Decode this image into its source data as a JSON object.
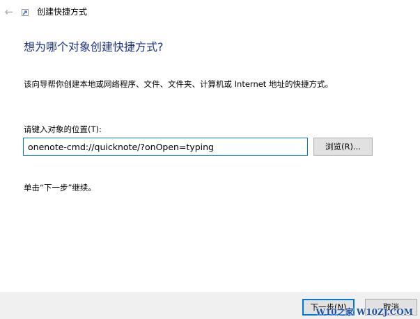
{
  "window": {
    "title": "创建快捷方式",
    "back_icon": "arrow-left-icon",
    "app_icon": "shortcut-icon"
  },
  "content": {
    "heading": "想为哪个对象创建快捷方式?",
    "description": "该向导帮你创建本地或网络程序、文件、文件夹、计算机或 Internet 地址的快捷方式。",
    "location_label": "请键入对象的位置(T):",
    "location_value": "onenote-cmd://quicknote/?onOpen=typing",
    "browse_label": "浏览(R)...",
    "hint": "单击“下一步”继续。"
  },
  "footer": {
    "next_label": "下一步(N)",
    "cancel_label": "取消"
  },
  "watermark": {
    "text": "W10之家 W10ZJ.COM"
  },
  "colors": {
    "heading": "#1e3287",
    "accent": "#0078d7",
    "footer_bg": "#f0f0f0",
    "button_bg": "#e1e1e1"
  }
}
